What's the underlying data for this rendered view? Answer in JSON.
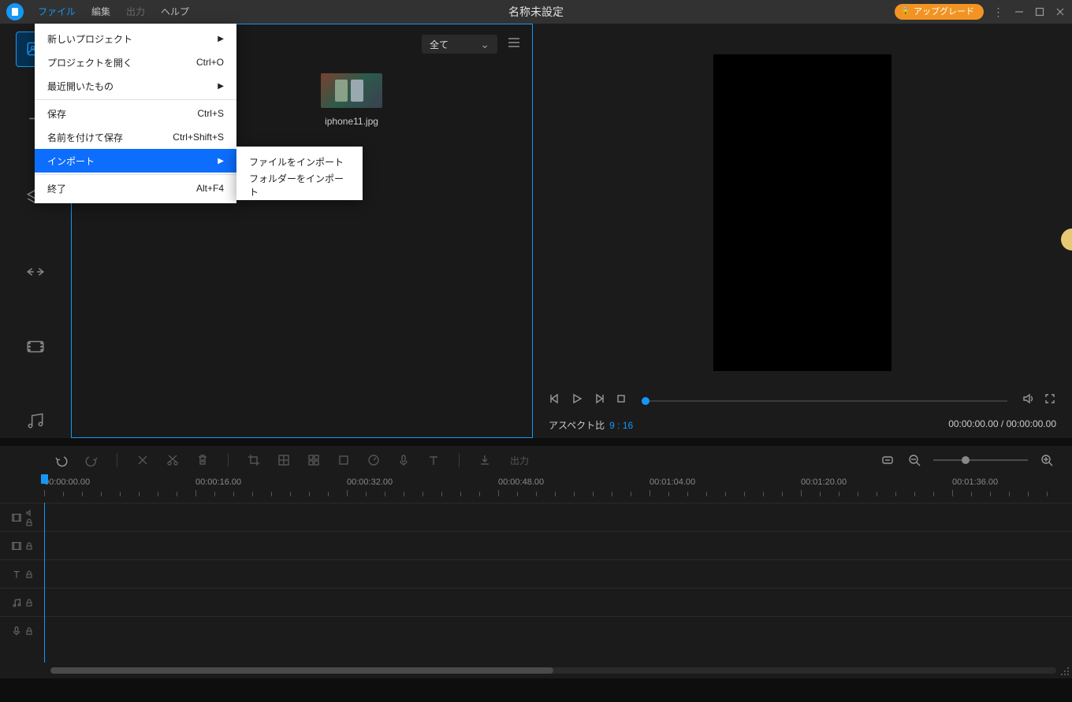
{
  "menubar": {
    "file": "ファイル",
    "edit": "編集",
    "output": "出力",
    "help": "ヘルプ"
  },
  "title": "名称未設定",
  "upgrade": "アップグレード",
  "dropdown": {
    "new_project": "新しいプロジェクト",
    "open_project": "プロジェクトを開く",
    "open_project_sc": "Ctrl+O",
    "recent": "最近開いたもの",
    "save": "保存",
    "save_sc": "Ctrl+S",
    "save_as": "名前を付けて保存",
    "save_as_sc": "Ctrl+Shift+S",
    "import": "インポート",
    "exit": "終了",
    "exit_sc": "Alt+F4"
  },
  "submenu": {
    "import_file": "ファイルをインポート",
    "import_folder": "フォルダーをインポート"
  },
  "media": {
    "filter": "全て",
    "thumb_name": "iphone11.jpg"
  },
  "preview": {
    "aspect_label": "アスペクト比",
    "aspect_value": "9 : 16",
    "time": "00:00:00.00 / 00:00:00.00"
  },
  "toolbar": {
    "output": "出力"
  },
  "ruler": [
    "00:00:00.00",
    "00:00:16.00",
    "00:00:32.00",
    "00:00:48.00",
    "00:01:04.00",
    "00:01:20.00",
    "00:01:36.00"
  ]
}
